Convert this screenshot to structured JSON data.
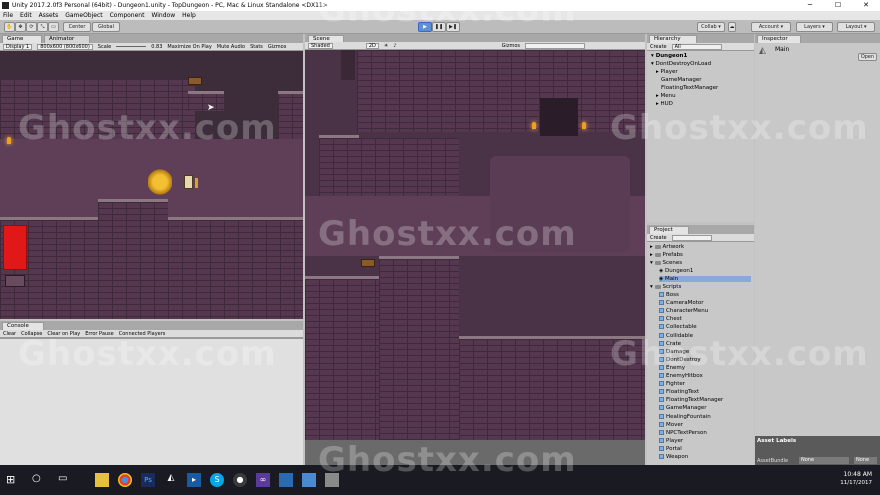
{
  "window": {
    "title": "Unity 2017.2.0f3 Personal (64bit) - Dungeon1.unity - TopDungeon - PC, Mac & Linux Standalone <DX11>",
    "controls": [
      "─",
      "☐",
      "✕"
    ]
  },
  "menu": [
    "File",
    "Edit",
    "Assets",
    "GameObject",
    "Component",
    "Window",
    "Help"
  ],
  "toolbar": {
    "pivot": "Center",
    "space": "Global",
    "collab": "Collab ▾",
    "account": "Account ▾",
    "layers": "Layers",
    "layout": "Layout"
  },
  "game_panel": {
    "tabs": [
      "Game",
      "Animator"
    ],
    "display": "Display 1",
    "resolution": "800x600 (800x600)",
    "scale_label": "Scale",
    "scale_value": "0.83",
    "options": [
      "Maximize On Play",
      "Mute Audio",
      "Stats",
      "Gizmos"
    ]
  },
  "scene_panel": {
    "tab": "Scene",
    "shading": "Shaded",
    "mode_2d": "2D",
    "gizmos": "Gizmos",
    "search_placeholder": "All"
  },
  "console_panel": {
    "tab": "Console",
    "buttons": [
      "Clear",
      "Collapse",
      "Clear on Play",
      "Error Pause",
      "Connected Players"
    ]
  },
  "hierarchy": {
    "tab": "Hierarchy",
    "create": "Create",
    "search_placeholder": "All",
    "items": [
      {
        "label": "Dungeon1",
        "level": 0,
        "bold": true
      },
      {
        "label": "DontDestroyOnLoad",
        "level": 0,
        "bold": false
      },
      {
        "label": "Player",
        "level": 1,
        "bold": false
      },
      {
        "label": "GameManager",
        "level": 1,
        "bold": false
      },
      {
        "label": "FloatingTextManager",
        "level": 1,
        "bold": false
      },
      {
        "label": "Menu",
        "level": 1,
        "bold": false
      },
      {
        "label": "HUD",
        "level": 1,
        "bold": false
      }
    ]
  },
  "project": {
    "tab": "Project",
    "create": "Create",
    "folders": [
      "Artwork",
      "Prefabs",
      "Scenes"
    ],
    "scenes": [
      "Dungeon1",
      "Main"
    ],
    "scripts_folder": "Scripts",
    "scripts": [
      "Boss",
      "CameraMotor",
      "CharacterMenu",
      "Chest",
      "Collectable",
      "Collidable",
      "Crate",
      "Damage",
      "DontDestroy",
      "Enemy",
      "EnemyHitbox",
      "Fighter",
      "FloatingText",
      "FloatingTextManager",
      "GameManager",
      "HealingFountain",
      "Mover",
      "NPCTextPerson",
      "Player",
      "Portal",
      "Weapon"
    ]
  },
  "inspector": {
    "tab": "Inspector",
    "object_name": "Main",
    "open_button": "Open",
    "asset_labels": "Asset Labels",
    "asset_bundle_label": "AssetBundle",
    "asset_bundle_value": "None",
    "asset_bundle_variant": "None"
  },
  "taskbar": {
    "time": "10:48 AM",
    "date": "11/17/2017"
  },
  "watermark": "Ghostxx.com",
  "colors": {
    "play_accent": "#5f8fd6",
    "dungeon_bg": "#3d2c3a",
    "brick": "#55384f",
    "health_bar": "#e01818"
  }
}
